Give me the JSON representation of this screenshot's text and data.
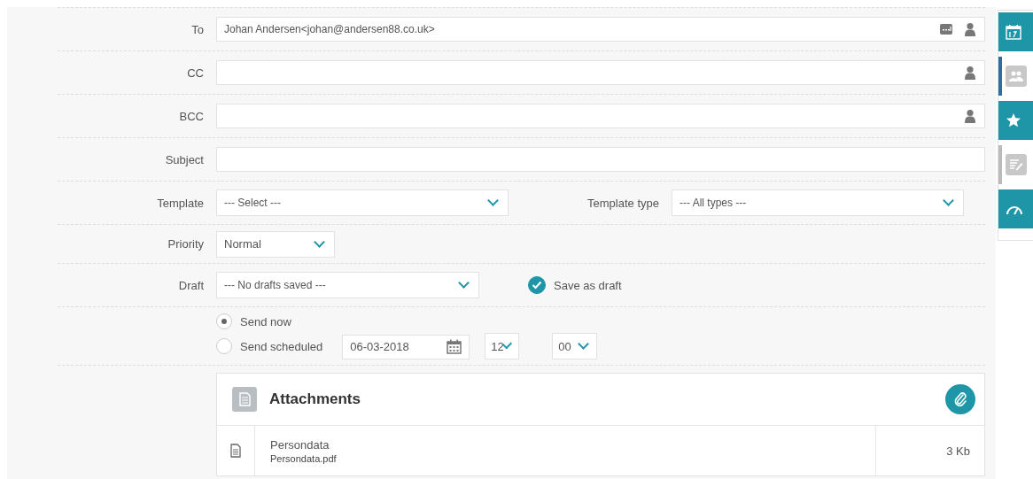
{
  "recipients": [
    {
      "label": "To",
      "value": "Johan Andersen<johan@andersen88.co.uk>",
      "address_book": true
    },
    {
      "label": "CC",
      "address_book": false
    },
    {
      "label": "BCC",
      "address_book": false
    }
  ],
  "subject": {
    "label": "Subject"
  },
  "template": {
    "label": "Template",
    "value": "--- Select ---"
  },
  "template_type": {
    "label": "Template type",
    "value": "--- All types ---"
  },
  "priority": {
    "label": "Priority",
    "value": "Normal"
  },
  "draft": {
    "label": "Draft",
    "value": "--- No drafts saved ---",
    "save_label": "Save as draft",
    "save_checked": true
  },
  "schedule": {
    "options": [
      {
        "label": "Send now",
        "selected": true
      },
      {
        "label": "Send scheduled",
        "selected": false
      }
    ],
    "date": "06-03-2018",
    "hour": "12",
    "minute": "00"
  },
  "attachments": {
    "title": "Attachments",
    "files": [
      {
        "name": "Persondata",
        "filename": "Persondata.pdf",
        "size": "3 Kb"
      }
    ]
  },
  "side_tabs": [
    {
      "kind": "calendar",
      "selected": false
    },
    {
      "kind": "contacts",
      "selected": true
    },
    {
      "kind": "star",
      "selected": false
    },
    {
      "kind": "notes",
      "selected": false
    },
    {
      "kind": "gauge",
      "selected": false
    }
  ]
}
